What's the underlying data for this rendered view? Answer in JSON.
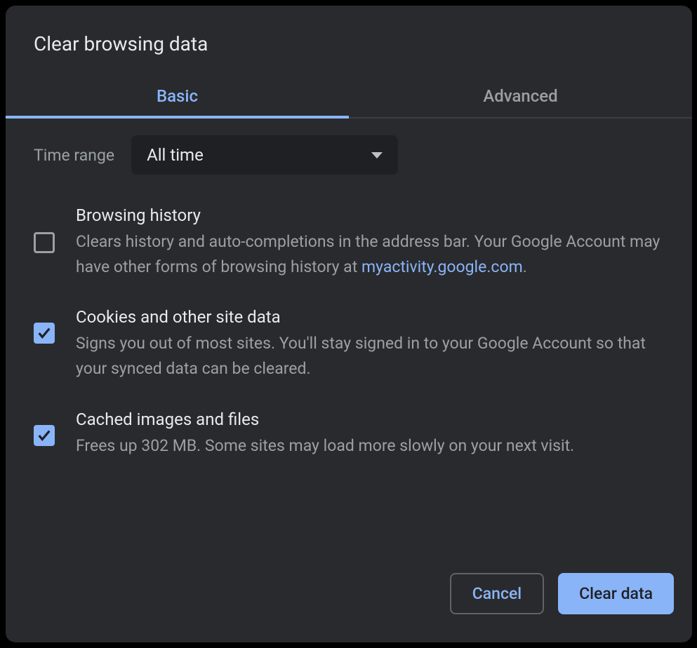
{
  "dialog": {
    "title": "Clear browsing data",
    "tabs": [
      {
        "label": "Basic",
        "active": true
      },
      {
        "label": "Advanced",
        "active": false
      }
    ],
    "time_range": {
      "label": "Time range",
      "value": "All time"
    },
    "options": [
      {
        "checked": false,
        "title": "Browsing history",
        "desc_prefix": "Clears history and auto-completions in the address bar. Your Google Account may have other forms of browsing history at ",
        "link_text": "myactivity.google.com",
        "desc_suffix": "."
      },
      {
        "checked": true,
        "title": "Cookies and other site data",
        "desc": "Signs you out of most sites. You'll stay signed in to your Google Account so that your synced data can be cleared."
      },
      {
        "checked": true,
        "title": "Cached images and files",
        "desc": "Frees up 302 MB. Some sites may load more slowly on your next visit."
      }
    ],
    "actions": {
      "cancel": "Cancel",
      "confirm": "Clear data"
    }
  }
}
